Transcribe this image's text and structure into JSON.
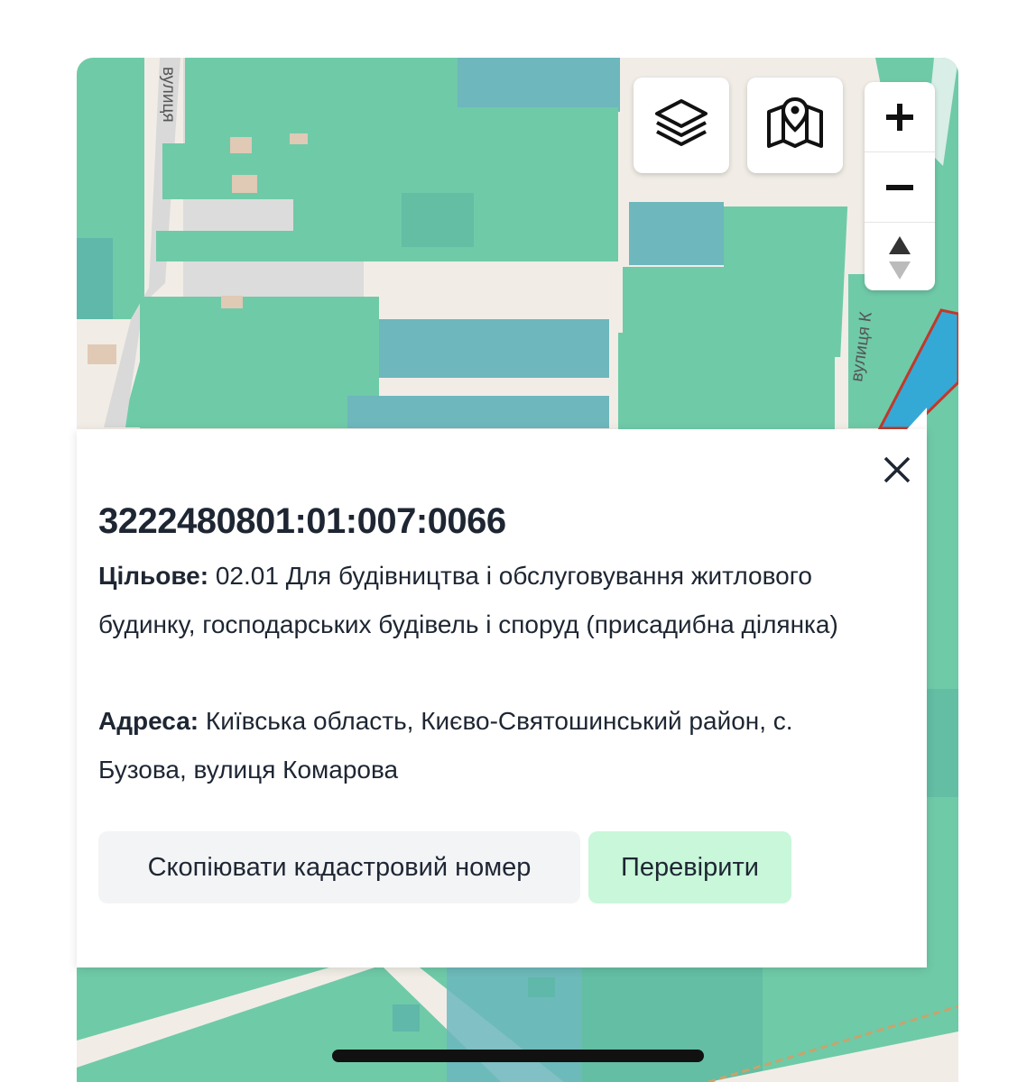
{
  "map": {
    "street_labels": [
      "вулиця",
      "вулиця К"
    ],
    "colors": {
      "parcel": "#6fcaa8",
      "parcel_dark": "#5fb8a9",
      "parcel_blue": "#6db7bd",
      "selected": "#35a9d6",
      "selected_border": "#c0392b",
      "road": "#f1ede6",
      "building": "#e0c9b5"
    }
  },
  "controls": {
    "layers_icon": "layers-icon",
    "maps_icon": "map-pin-icon",
    "zoom_in": "+",
    "zoom_out": "−",
    "compass_icon": "compass-arrows-icon"
  },
  "popup": {
    "cadastral_number": "3222480801:01:007:0066",
    "purpose_label": "Цільове:",
    "purpose_value": " 02.01 Для будівництва і обслуговування житлового будинку, господарських будівель і споруд (присадибна ділянка)",
    "address_label": "Адреса:",
    "address_value": " Київська область, Києво-Святошинський район, с. Бузова, вулиця Комарова",
    "copy_button": "Скопіювати кадастровий номер",
    "check_button": "Перевірити",
    "close_icon": "close-icon"
  }
}
